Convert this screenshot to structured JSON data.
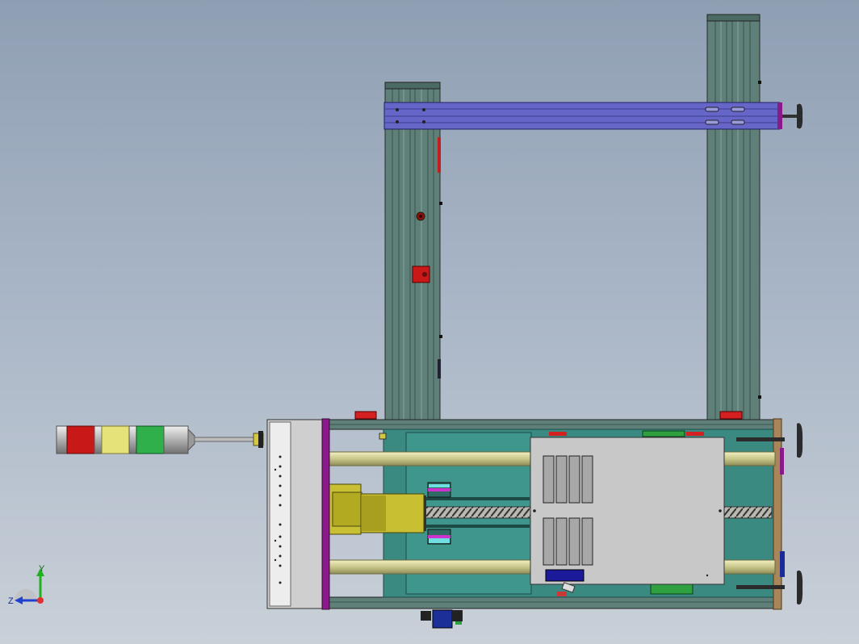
{
  "viewport": {
    "background_top": "#8f9fb3",
    "background_bottom": "#c9d0d8"
  },
  "triad": {
    "x_label": "",
    "y_label": "Y",
    "z_label": "Z",
    "x_color": "#e03030",
    "y_color": "#20b020",
    "z_color": "#2040d0"
  },
  "stack_light": {
    "colors": [
      "#c81818",
      "#e6e27a",
      "#2fb04a"
    ]
  },
  "colors": {
    "frame_profile": "#5e8079",
    "crossbeam": "#6666c8",
    "end_plate": "#8a1a8a",
    "guide_rod": "#d8d89a",
    "motor": "#c8c032",
    "panel": "#c8c8c8",
    "base_plate": "#3a8a82",
    "alarm_red": "#d42020"
  }
}
